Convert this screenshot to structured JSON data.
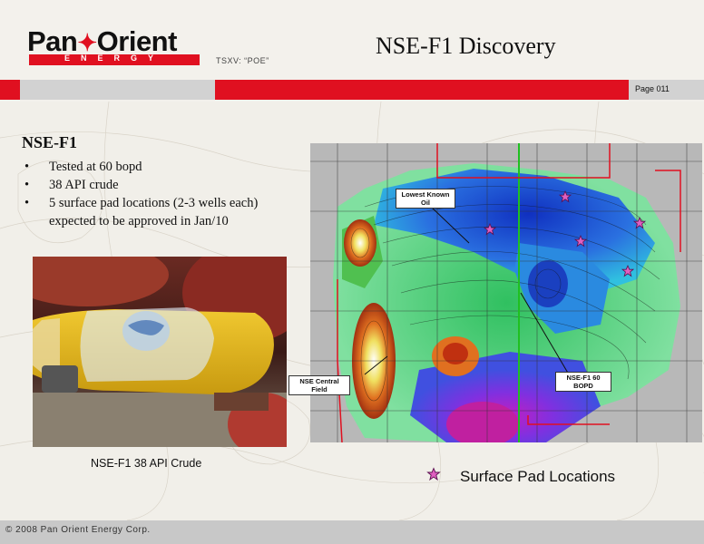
{
  "header": {
    "logo_main": "Pan♥Orient",
    "logo_left": "Pan",
    "logo_right": "Orient",
    "logo_sub": "ENERGY",
    "ticker": "TSXV: “POE”",
    "title": "NSE-F1 Discovery",
    "page_label": "Page 011"
  },
  "content": {
    "heading": "NSE-F1",
    "bullets": [
      "Tested at 60 bopd",
      "38 API crude",
      "5 surface pad locations (2-3 wells each) expected to be approved in Jan/10"
    ],
    "bullet_glyph": "•",
    "photo_caption": "NSE-F1 38 API Crude"
  },
  "map": {
    "callouts": {
      "lowest_known_oil": "Lowest Known Oil",
      "nse_central": "NSE Central Field",
      "nse_f1": "NSE-F1 60 BOPD"
    },
    "legend_label": "Surface Pad Locations",
    "star_color": "#e060c0"
  },
  "footer": {
    "text": "© 2008 Pan Orient Energy Corp."
  },
  "colors": {
    "brand_red": "#e01020",
    "band_gray": "#d2d2d2"
  }
}
